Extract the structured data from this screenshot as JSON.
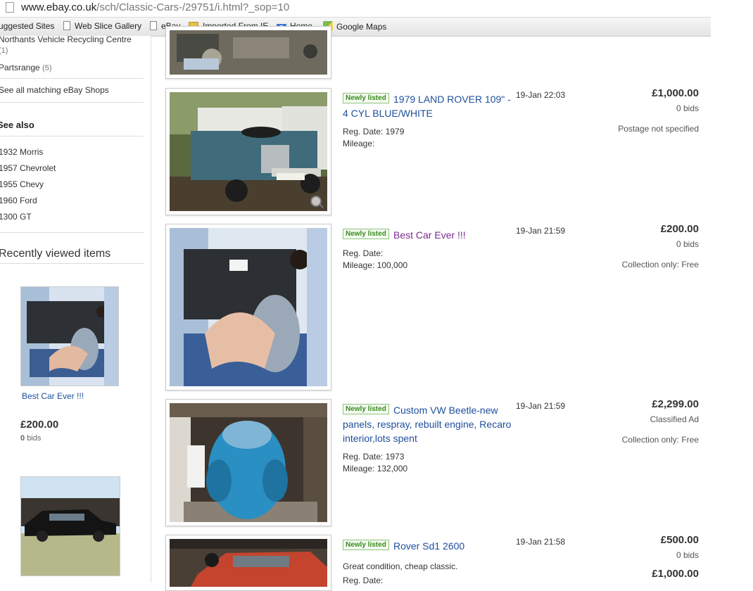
{
  "browser": {
    "url_host": "www.ebay.co.uk",
    "url_path": "/sch/Classic-Cars-/29751/i.html?_sop=10"
  },
  "bookmarks": [
    {
      "label": "uggested Sites",
      "icon": "page-icon"
    },
    {
      "label": "Web Slice Gallery",
      "icon": "page-icon"
    },
    {
      "label": "eBay",
      "icon": "page-icon"
    },
    {
      "label": "Imported From IE",
      "icon": "folder-icon"
    },
    {
      "label": "Home",
      "icon": "google-icon"
    },
    {
      "label": "Google Maps",
      "icon": "maps-icon"
    }
  ],
  "sidebar": {
    "shops": [
      {
        "label": "Northants Vehicle Recycling Centre",
        "count": "(1)"
      },
      {
        "label": "Partsrange",
        "count": "(5)"
      }
    ],
    "see_all": "See all matching eBay Shops",
    "see_also_heading": "See also",
    "see_also": [
      "1932 Morris",
      "1957 Chevrolet",
      "1955 Chevy",
      "1960 Ford",
      "1300 GT"
    ],
    "recent_heading": "Recently viewed items",
    "recent": [
      {
        "title": "Best Car Ever !!!",
        "price": "£200.00",
        "bids_num": "0",
        "bids_label": "bids"
      }
    ]
  },
  "listings": [
    {
      "badge": "Newly listed",
      "title": "1979 LAND ROVER 109\" - 4 CYL BLUE/WHITE",
      "meta1": "Reg. Date: 1979",
      "meta2": "Mileage:",
      "time": "19-Jan 22:03",
      "price": "£1,000.00",
      "sub1": "0 bids",
      "sub2": "Postage not specified"
    },
    {
      "badge": "Newly listed",
      "title": "Best Car Ever !!!",
      "meta1": "Reg. Date:",
      "meta2": "Mileage: 100,000",
      "time": "19-Jan 21:59",
      "price": "£200.00",
      "sub1": "0 bids",
      "sub2": "Collection only: Free"
    },
    {
      "badge": "Newly listed",
      "title": "Custom VW Beetle-new panels, respray, rebuilt engine, Recaro interior,lots spent",
      "meta1": "Reg. Date: 1973",
      "meta2": "Mileage: 132,000",
      "time": "19-Jan 21:59",
      "price": "£2,299.00",
      "sub1": "Classified Ad",
      "sub2": "Collection only: Free"
    },
    {
      "badge": "Newly listed",
      "title": "Rover Sd1 2600",
      "meta1": "Great condition, cheap classic.",
      "meta2": "Reg. Date:",
      "time": "19-Jan 21:58",
      "price": "£500.00",
      "sub1": "0 bids",
      "price2": "£1,000.00"
    }
  ]
}
